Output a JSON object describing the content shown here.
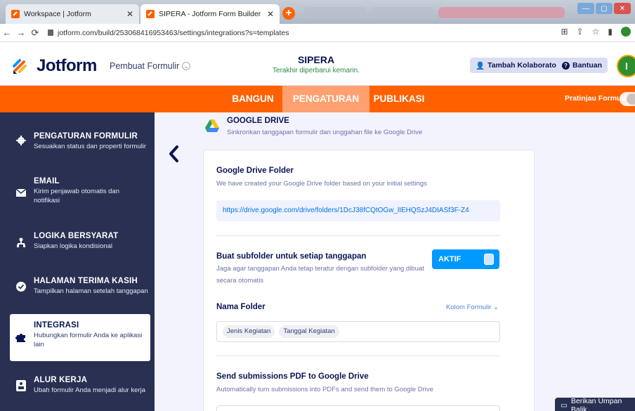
{
  "browser": {
    "tabs": [
      {
        "title": "Workspace | Jotform"
      },
      {
        "title": "SIPERA - Jotform Form Builder"
      }
    ],
    "new_tab": "+",
    "url": "jotform.com/build/253068416953463/settings/integrations?s=templates"
  },
  "header": {
    "logo_text": "Jotform",
    "builder_label": "Pembuat Formulir",
    "form_title": "SIPERA",
    "form_subtitle": "Terakhir diperbarui kemarin.",
    "collab_label": "Tambah Kolaborator",
    "help_label": "Bantuan",
    "avatar_initial": "I"
  },
  "topnav": {
    "tabs": [
      "BANGUN",
      "PENGATURAN",
      "PUBLIKASI"
    ],
    "active": "PENGATURAN",
    "preview_label": "Pratinjau Formulir"
  },
  "sidebar": {
    "items": [
      {
        "title": "PENGATURAN FORMULIR",
        "desc": "Sesuaikan status dan properti formulir",
        "icon": "gear-icon"
      },
      {
        "title": "EMAIL",
        "desc": "Kirim penjawab otomatis dan notifikasi",
        "icon": "envelope-icon"
      },
      {
        "title": "LOGIKA BERSYARAT",
        "desc": "Siapkan logika kondisional",
        "icon": "logic-tree-icon"
      },
      {
        "title": "HALAMAN TERIMA KASIH",
        "desc": "Tampilkan halaman setelah tanggapan",
        "icon": "check-circle-icon"
      },
      {
        "title": "INTEGRASI",
        "desc": "Hubungkan formulir Anda ke aplikasi lain",
        "icon": "puzzle-icon"
      },
      {
        "title": "ALUR KERJA",
        "desc": "Ubah formulir Anda menjadi alur kerja",
        "icon": "workflow-icon"
      }
    ],
    "active_index": 4
  },
  "integration": {
    "title": "GOOGLE DRIVE",
    "subtitle": "Sinkronkan tanggapan formulir dan unggahan file ke Google Drive",
    "folder_label": "Google Drive Folder",
    "folder_desc": "We have created your Google Drive folder based on your initial settings",
    "folder_link": "https://drive.google.com/drive/folders/1DcJ38fCQtOGw_lIEHQSzJ4DIASf3F-Z4",
    "subfolder_label": "Buat subfolder untuk setiap tanggapan",
    "subfolder_desc": "Jaga agar tanggapan Anda tetap teratur dengan subfolder yang dibuat secara otomatis",
    "subfolder_toggle": "AKTIF",
    "folder_name_label": "Nama Folder",
    "form_fields_label": "Kolom Formulir",
    "folder_tags": [
      "Jenis Kegiatan",
      "Tanggal Kegiatan"
    ],
    "pdf_label": "Send submissions PDF to Google Drive",
    "pdf_desc": "Automatically turn submissions into PDFs and send them to Google Drive"
  },
  "feedback_label": "Berikan Umpan Balik",
  "colors": {
    "brand_orange": "#ff6100",
    "sidebar_bg": "#293052",
    "toggle_blue": "#0099ff",
    "navy": "#0a1551"
  }
}
